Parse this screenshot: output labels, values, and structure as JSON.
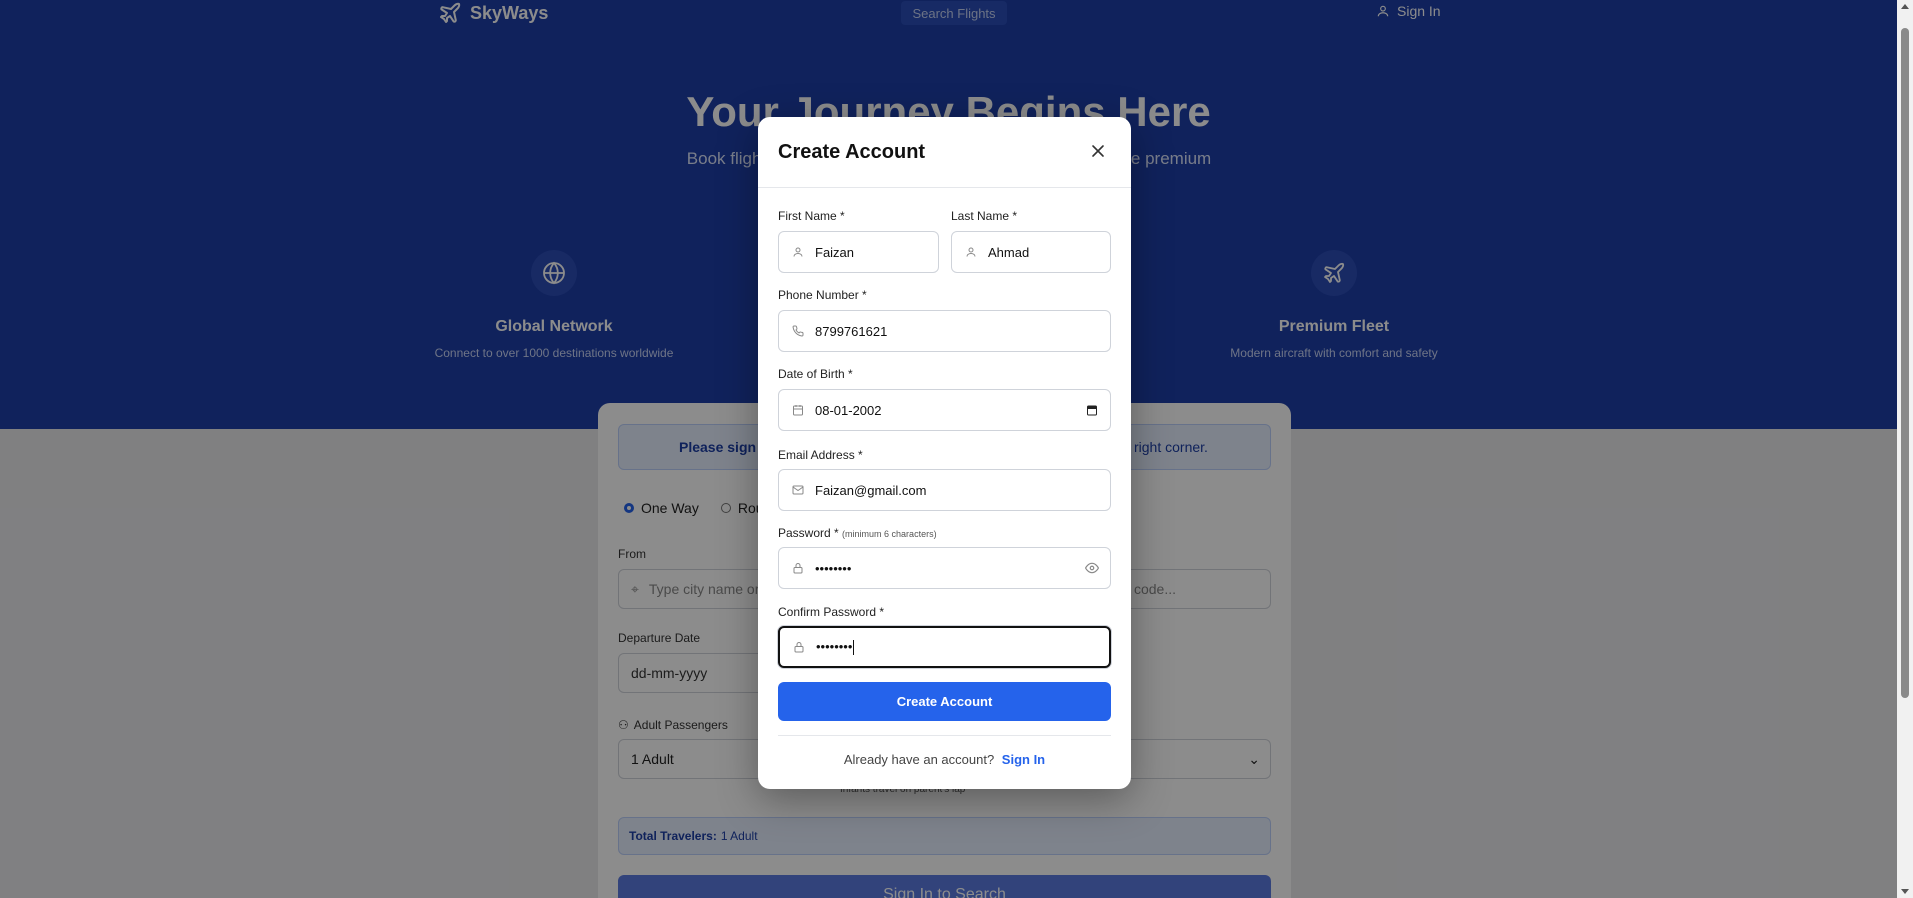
{
  "nav": {
    "brand": "SkyWays",
    "search_flights": "Search Flights",
    "sign_in": "Sign In"
  },
  "hero": {
    "title": "Your Journey Begins Here",
    "subtitle": "Book flights to destinations worldwide with ease. Experience premium service and competitive prices on every booking."
  },
  "features": [
    {
      "icon": "globe-icon",
      "title": "Global Network",
      "desc": "Connect to over 1000 destinations worldwide"
    },
    {
      "icon": "plane-icon",
      "title": "Premium Fleet",
      "desc": "Modern aircraft with comfort and safety"
    }
  ],
  "search_card": {
    "notice_left": "Please sign in",
    "notice_right": "right corner.",
    "trip_one_way": "One Way",
    "trip_round": "Rou",
    "from_label": "From",
    "from_placeholder": "Type city name or",
    "to_placeholder": "code...",
    "departure_label": "Departure Date",
    "departure_placeholder": "dd-mm-yyyy",
    "adults_label": "Adult Passengers",
    "adults_value": "1 Adult",
    "infants_note": "Infants travel on parent's lap",
    "total_label": "Total Travelers:",
    "total_value": "1 Adult",
    "search_button": "Sign In to Search"
  },
  "modal": {
    "title": "Create Account",
    "first_name_label": "First Name *",
    "first_name_value": "Faizan",
    "last_name_label": "Last Name *",
    "last_name_value": "Ahmad",
    "phone_label": "Phone Number *",
    "phone_value": "8799761621",
    "dob_label": "Date of Birth *",
    "dob_value": "08-01-2002",
    "email_label": "Email Address *",
    "email_value": "Faizan@gmail.com",
    "password_label": "Password *",
    "password_hint": "(minimum 6 characters)",
    "password_value": "••••••••",
    "confirm_label": "Confirm Password *",
    "confirm_value": "••••••••",
    "create_button": "Create Account",
    "footer_text": "Already have an account?",
    "footer_link": "Sign In"
  },
  "colors": {
    "hero_bg": "#1e3ea8",
    "primary": "#2563eb",
    "overlay": "rgba(0,0,0,0.45)"
  }
}
